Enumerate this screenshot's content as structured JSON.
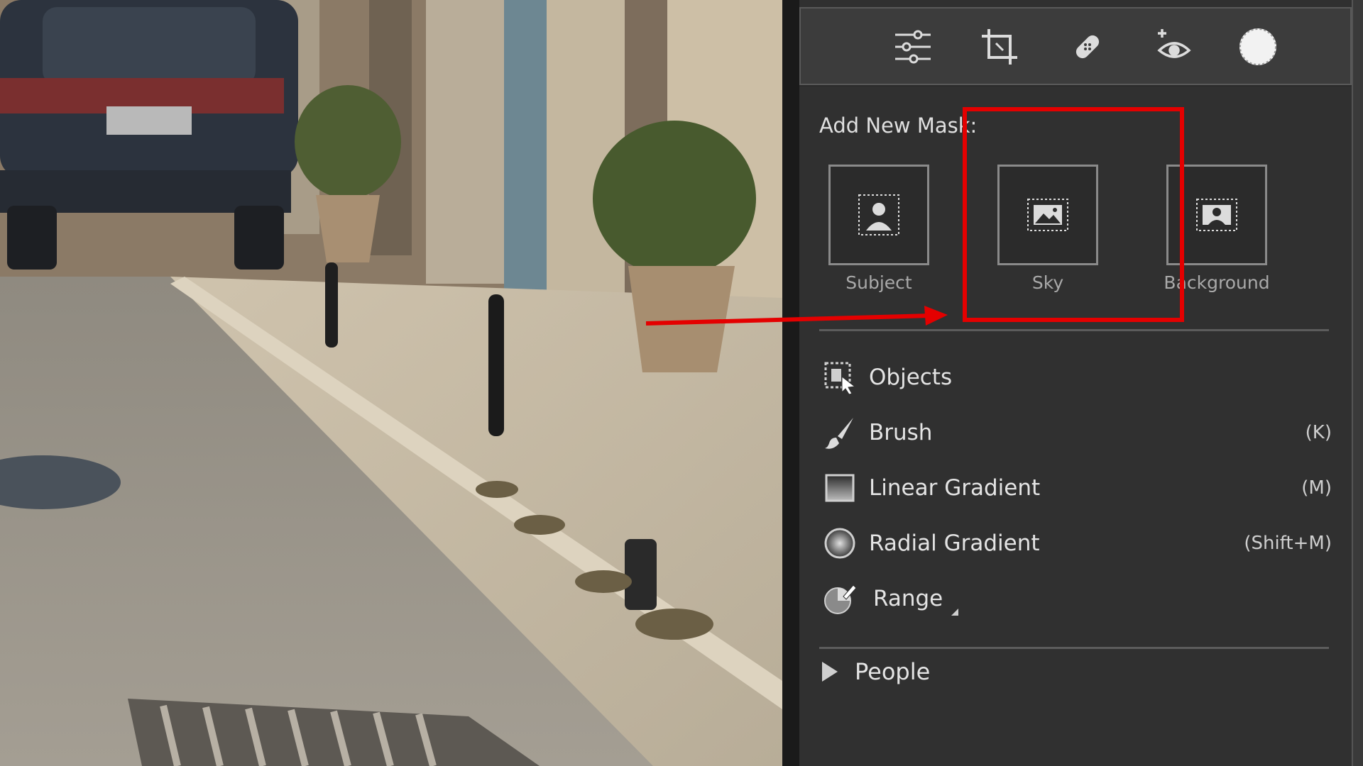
{
  "toolstrip": {
    "tools": [
      {
        "icon": "sliders-icon"
      },
      {
        "icon": "crop-icon"
      },
      {
        "icon": "healing-bandage-icon"
      },
      {
        "icon": "red-eye-icon"
      },
      {
        "icon": "masking-icon"
      }
    ]
  },
  "mask_panel": {
    "title": "Add New Mask:",
    "quick_masks": [
      {
        "label": "Subject",
        "icon": "subject-person-icon"
      },
      {
        "label": "Sky",
        "icon": "sky-image-icon"
      },
      {
        "label": "Background",
        "icon": "background-icon"
      }
    ],
    "tools": [
      {
        "label": "Objects",
        "shortcut": "",
        "icon": "objects-select-icon"
      },
      {
        "label": "Brush",
        "shortcut": "(K)",
        "icon": "brush-icon"
      },
      {
        "label": "Linear Gradient",
        "shortcut": "(M)",
        "icon": "linear-gradient-icon"
      },
      {
        "label": "Radial Gradient",
        "shortcut": "(Shift+M)",
        "icon": "radial-gradient-icon"
      },
      {
        "label": "Range",
        "shortcut": "",
        "icon": "range-picker-icon"
      }
    ],
    "people_section": {
      "label": "People"
    }
  },
  "annotation": {
    "highlight_color": "#e40000",
    "highlighted_item": "Sky"
  }
}
